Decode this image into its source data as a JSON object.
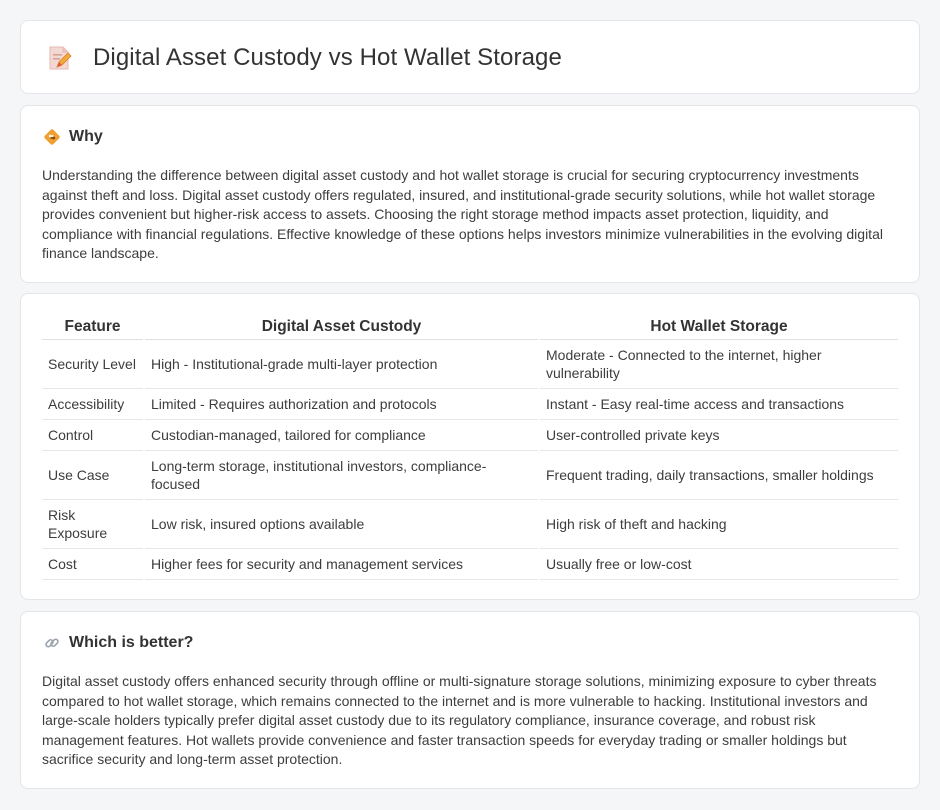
{
  "header": {
    "title": "Digital Asset Custody vs Hot Wallet Storage",
    "icon": "document-pencil-icon"
  },
  "why": {
    "icon": "diamond-arrows-icon",
    "title": "Why",
    "body": "Understanding the difference between digital asset custody and hot wallet storage is crucial for securing cryptocurrency investments against theft and loss. Digital asset custody offers regulated, insured, and institutional-grade security solutions, while hot wallet storage provides convenient but higher-risk access to assets. Choosing the right storage method impacts asset protection, liquidity, and compliance with financial regulations. Effective knowledge of these options helps investors minimize vulnerabilities in the evolving digital finance landscape."
  },
  "comparison": {
    "headers": [
      "Feature",
      "Digital Asset Custody",
      "Hot Wallet Storage"
    ],
    "rows": [
      [
        "Security Level",
        "High - Institutional-grade multi-layer protection",
        "Moderate - Connected to the internet, higher vulnerability"
      ],
      [
        "Accessibility",
        "Limited - Requires authorization and protocols",
        "Instant - Easy real-time access and transactions"
      ],
      [
        "Control",
        "Custodian-managed, tailored for compliance",
        "User-controlled private keys"
      ],
      [
        "Use Case",
        "Long-term storage, institutional investors, compliance-focused",
        "Frequent trading, daily transactions, smaller holdings"
      ],
      [
        "Risk Exposure",
        "Low risk, insured options available",
        "High risk of theft and hacking"
      ],
      [
        "Cost",
        "Higher fees for security and management services",
        "Usually free or low-cost"
      ]
    ]
  },
  "better": {
    "icon": "link-icon",
    "title": "Which is better?",
    "body": "Digital asset custody offers enhanced security through offline or multi-signature storage solutions, minimizing exposure to cyber threats compared to hot wallet storage, which remains connected to the internet and is more vulnerable to hacking. Institutional investors and large-scale holders typically prefer digital asset custody due to its regulatory compliance, insurance coverage, and robust risk management features. Hot wallets provide convenience and faster transaction speeds for everyday trading or smaller holdings but sacrifice security and long-term asset protection."
  },
  "colors": {
    "background": "#f5f6f8",
    "card": "#ffffff",
    "border": "#e3e5e8",
    "text": "#3a3a3a",
    "accent_orange": "#f0a030",
    "accent_red": "#e0533d"
  }
}
